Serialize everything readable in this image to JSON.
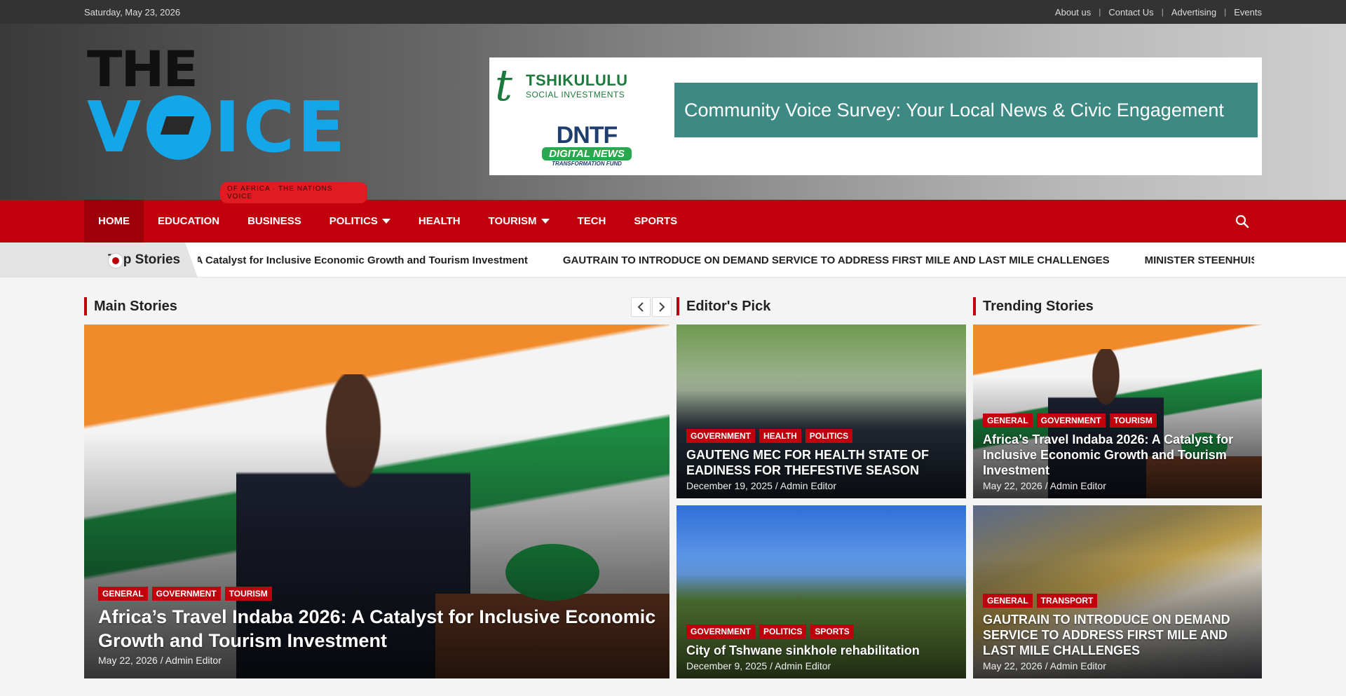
{
  "topbar": {
    "date": "Saturday, May 23, 2026",
    "links": [
      "About us",
      "Contact Us",
      "Advertising",
      "Events"
    ]
  },
  "header": {
    "logo": {
      "line1": "THE",
      "line2_a": "V",
      "line2_b": "ICE",
      "tagline": "OF AFRICA · THE NATIONS VOICE"
    },
    "banner": {
      "sponsor1_name": "TSHIKULULU",
      "sponsor1_sub": "SOCIAL INVESTMENTS",
      "sponsor2_name": "DNTF",
      "sponsor2_badge": "DIGITAL NEWS",
      "sponsor2_sub": "TRANSFORMATION FUND",
      "survey_text": "Community Voice Survey: Your Local News & Civic Engagement"
    }
  },
  "nav": {
    "items": [
      {
        "label": "Home",
        "active": true,
        "dropdown": false
      },
      {
        "label": "Education",
        "active": false,
        "dropdown": false
      },
      {
        "label": "Business",
        "active": false,
        "dropdown": false
      },
      {
        "label": "Politics",
        "active": false,
        "dropdown": true
      },
      {
        "label": "Health",
        "active": false,
        "dropdown": false
      },
      {
        "label": "Tourism",
        "active": false,
        "dropdown": true
      },
      {
        "label": "Tech",
        "active": false,
        "dropdown": false
      },
      {
        "label": "Sports",
        "active": false,
        "dropdown": false
      }
    ],
    "search_icon": "search-icon"
  },
  "ticker": {
    "label": "Top Stories",
    "items": [
      ": A Catalyst for Inclusive Economic Growth and Tourism Investment",
      "GAUTRAIN TO INTRODUCE ON DEMAND SERVICE TO ADDRESS FIRST MILE AND LAST MILE CHALLENGES",
      "MINISTER STEENHUISEN WELCOMES"
    ]
  },
  "sections": {
    "main": "Main Stories",
    "editors": "Editor's Pick",
    "trending": "Trending Stories"
  },
  "main_story": {
    "tags": [
      "GENERAL",
      "GOVERNMENT",
      "TOURISM"
    ],
    "title": "Africa’s Travel Indaba 2026: A Catalyst for Inclusive Economic Growth and Tourism Investment",
    "date": "May 22, 2026 / Admin Editor"
  },
  "editors_pick": [
    {
      "tags": [
        "GOVERNMENT",
        "HEALTH",
        "POLITICS"
      ],
      "title": "GAUTENG MEC FOR HEALTH STATE OF EADINESS FOR THEFESTIVE SEASON",
      "date": "December 19, 2025 / Admin Editor"
    },
    {
      "tags": [
        "GOVERNMENT",
        "POLITICS",
        "SPORTS"
      ],
      "title": "City of Tshwane sinkhole rehabilitation",
      "date": "December 9, 2025 / Admin Editor"
    }
  ],
  "trending": [
    {
      "tags": [
        "GENERAL",
        "GOVERNMENT",
        "TOURISM"
      ],
      "title": "Africa’s Travel Indaba 2026: A Catalyst for Inclusive Economic Growth and Tourism Investment",
      "date": "May 22, 2026 / Admin Editor"
    },
    {
      "tags": [
        "GENERAL",
        "TRANSPORT"
      ],
      "title": "GAUTRAIN TO INTRODUCE ON DEMAND SERVICE TO ADDRESS FIRST MILE AND LAST MILE CHALLENGES",
      "date": "May 22, 2026 / Admin Editor"
    }
  ],
  "colors": {
    "accent": "#c0000c",
    "nav_active": "#9e0009",
    "logo_blue": "#13a6e8",
    "survey_bg": "#3d8a84"
  }
}
